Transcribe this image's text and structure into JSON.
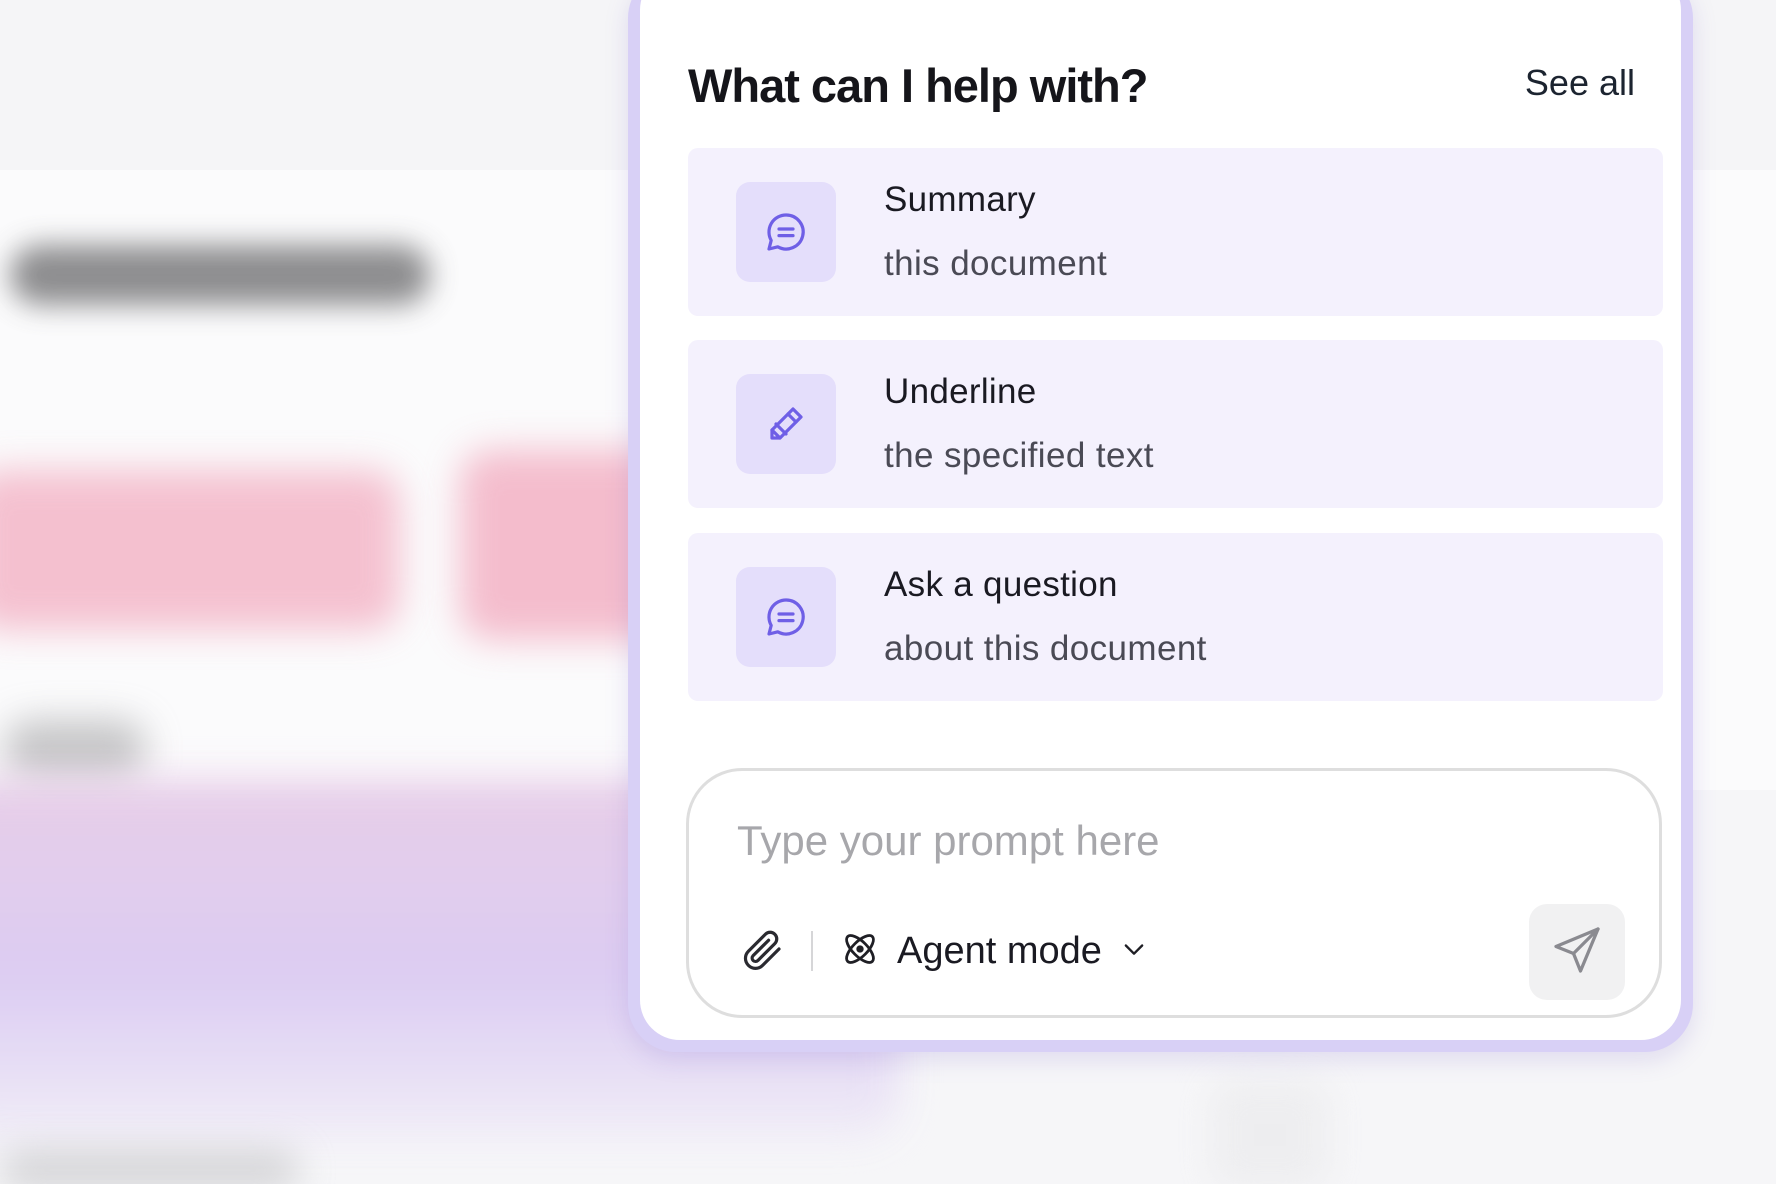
{
  "panel": {
    "title": "What can I help with?",
    "see_all_label": "See all"
  },
  "suggestions": [
    {
      "icon": "chat-bubble-icon",
      "title": "Summary",
      "subtitle": "this document"
    },
    {
      "icon": "pencil-icon",
      "title": "Underline",
      "subtitle": "the specified text"
    },
    {
      "icon": "chat-bubble-icon",
      "title": "Ask a question",
      "subtitle": "about this document"
    }
  ],
  "prompt": {
    "placeholder": "Type your prompt here",
    "value": "",
    "mode_label": "Agent mode",
    "attach_icon": "paperclip-icon",
    "mode_icon": "atom-icon",
    "send_icon": "send-icon"
  },
  "colors": {
    "accent": "#7b6cf0",
    "card_bg": "#f4f1fd",
    "icon_bg": "#e4defb",
    "panel_border": "#d8d0f6"
  }
}
